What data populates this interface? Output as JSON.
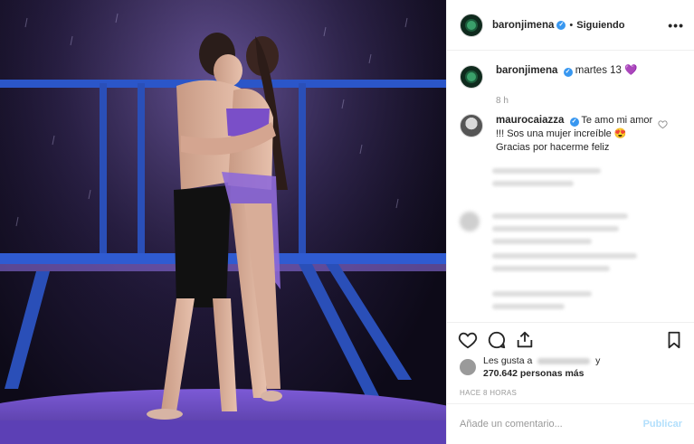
{
  "post": {
    "author": "baronjimena",
    "follow_status": "Siguiendo",
    "separator": "•",
    "more_label": "•••",
    "caption_text": "martes 13",
    "caption_emoji": "💜",
    "time_ago": "8 h"
  },
  "comment": {
    "username": "maurocaiazza",
    "text": "Te amo mi amor !!! Sos una mujer increíble 😍 Gracias por hacerme feliz"
  },
  "likes": {
    "prefix": "Les gusta a",
    "connector": "y",
    "count_text": "270.642 personas más"
  },
  "posted_label": "HACE 8 HORAS",
  "comment_box": {
    "placeholder": "Añade un comentario...",
    "publish_label": "Publicar"
  },
  "icons": {
    "like": "heart-outline-icon",
    "comment": "speech-bubble-icon",
    "share": "share-arrow-icon",
    "save": "bookmark-icon"
  },
  "colors": {
    "verified": "#3897f0",
    "publish_disabled": "#b2dffc",
    "stage_blue": "#2b56c9",
    "stage_purple": "#8b5cf6"
  }
}
